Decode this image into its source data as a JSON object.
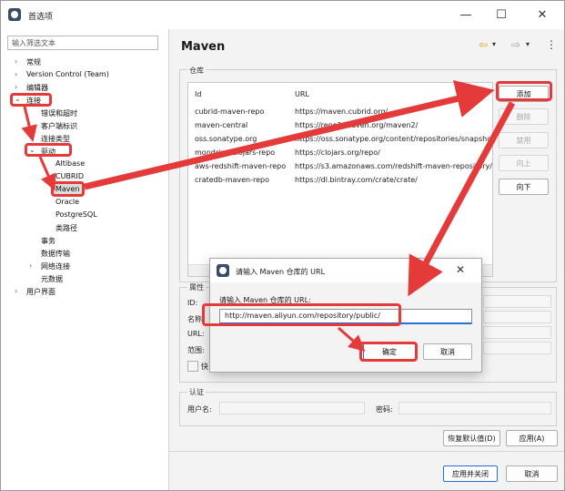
{
  "window": {
    "title": "首选项",
    "minimize_glyph": "—",
    "maximize_glyph": "☐",
    "close_glyph": "✕"
  },
  "sidebar": {
    "filter_placeholder": "输入筛选文本",
    "items": [
      {
        "label": "常规",
        "caret": "›"
      },
      {
        "label": "Version Control (Team)",
        "caret": "›"
      },
      {
        "label": "编辑器",
        "caret": "›"
      },
      {
        "label": "连接",
        "caret": "⌄"
      },
      {
        "label": "错误和超时"
      },
      {
        "label": "客户端标识"
      },
      {
        "label": "连接类型"
      },
      {
        "label": "驱动",
        "caret": "⌄"
      },
      {
        "label": "Altibase"
      },
      {
        "label": "CUBRID"
      },
      {
        "label": "Maven"
      },
      {
        "label": "Oracle"
      },
      {
        "label": "PostgreSQL"
      },
      {
        "label": "类路径"
      },
      {
        "label": "事务"
      },
      {
        "label": "数据传输"
      },
      {
        "label": "网络连接",
        "caret": "›"
      },
      {
        "label": "元数据"
      },
      {
        "label": "用户界面",
        "caret": "›"
      }
    ]
  },
  "main": {
    "page_title": "Maven",
    "back_glyph": "⇦",
    "forward_glyph": "⇨",
    "dropdown_glyph": "▾",
    "menu_glyph": "⋮",
    "repo_group_label": "仓库",
    "columns": [
      "Id",
      "URL"
    ],
    "repos": [
      {
        "id": "cubrid-maven-repo",
        "url": "https://maven.cubrid.org/"
      },
      {
        "id": "maven-central",
        "url": "https://repo1.maven.org/maven2/"
      },
      {
        "id": "oss.sonatype.org",
        "url": "https://oss.sonatype.org/content/repositories/snapshots/"
      },
      {
        "id": "mondrian-clojars-repo",
        "url": "https://clojars.org/repo/"
      },
      {
        "id": "aws-redshift-maven-repo",
        "url": "https://s3.amazonaws.com/redshift-maven-repository/release"
      },
      {
        "id": "cratedb-maven-repo",
        "url": "https://dl.bintray.com/crate/crate/"
      }
    ],
    "buttons": {
      "add": "添加",
      "delete": "删除",
      "disable": "禁用",
      "up": "向上",
      "down": "向下"
    },
    "props_group_label": "属性",
    "props": {
      "id_label": "ID:",
      "name_label": "名称:",
      "url_label": "URL:",
      "scope_label": "范围:",
      "check_label": "快"
    },
    "auth_group_label": "认证",
    "auth": {
      "user_label": "用户名:",
      "password_label": "密码:"
    },
    "restore_defaults": "恢复默认值(D)",
    "apply": "应用(A)",
    "apply_close": "应用并关闭",
    "cancel": "取消"
  },
  "dialog": {
    "title": "请输入 Maven 仓库的 URL",
    "prompt": "请输入 Maven 仓库的 URL:",
    "value": "http://maven.aliyun.com/repository/public/",
    "ok": "确定",
    "cancel": "取消",
    "close_glyph": "✕"
  },
  "colors": {
    "annotation_red": "#e53a3a",
    "focus_blue": "#2a6ed8",
    "nav_arrow_gold": "#e3a21a"
  }
}
